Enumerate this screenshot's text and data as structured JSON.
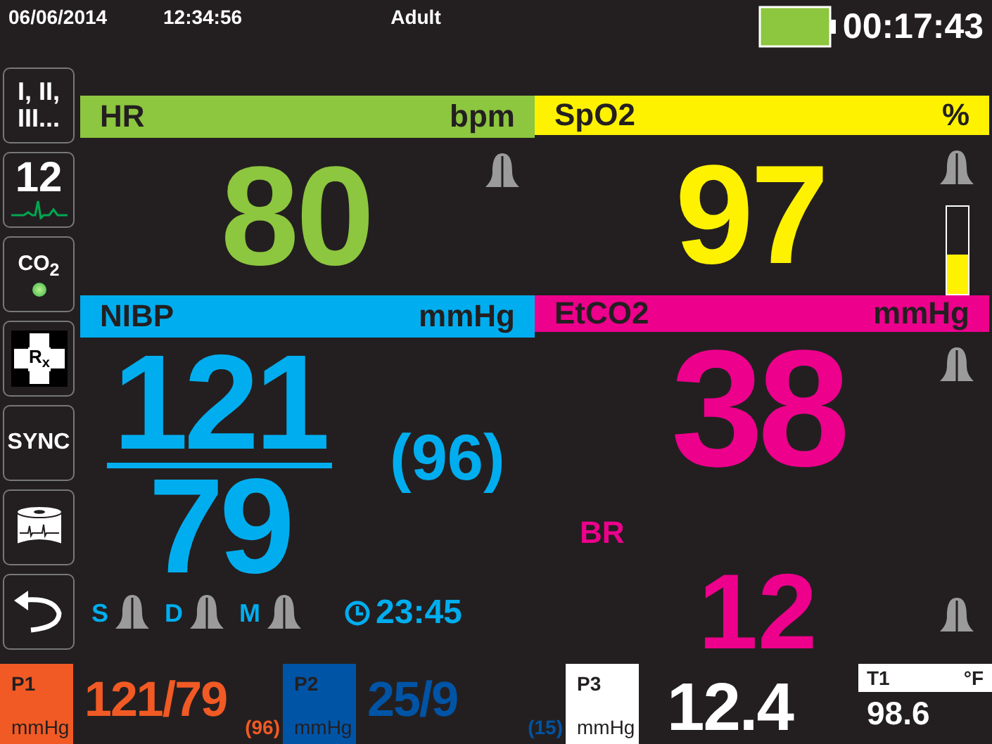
{
  "status_bar": {
    "date": "06/06/2014",
    "time": "12:34:56",
    "patient_mode": "Adult",
    "elapsed": "00:17:43"
  },
  "sidebar": {
    "buttons": [
      {
        "kind": "leads",
        "label": "I, II, III..."
      },
      {
        "kind": "twelve_lead",
        "label": "12"
      },
      {
        "kind": "co2",
        "label": "CO$_{2}$",
        "active": true
      },
      {
        "kind": "rx",
        "label": "R$_{x}$"
      },
      {
        "kind": "sync",
        "label": "SYNC"
      },
      {
        "kind": "print"
      },
      {
        "kind": "back"
      }
    ]
  },
  "vitals": [
    {
      "kind": "hr",
      "label": "HR",
      "unit": "bpm",
      "color": "#8dc63f",
      "value": "80"
    },
    {
      "kind": "spo2",
      "label": "SpO2",
      "unit": "%",
      "color": "#fff200",
      "value": "97",
      "level": 0.45
    },
    {
      "kind": "nibp",
      "label": "NIBP",
      "unit": "mmHg",
      "color": "#00aeef",
      "systolic": "121",
      "diastolic": "79",
      "mean": "(96)",
      "modes": [
        "S",
        "D",
        "M"
      ],
      "interval": "23:45"
    },
    {
      "kind": "etco2",
      "label": "EtCO2",
      "unit": "mmHg",
      "color": "#ec008c",
      "value": "38",
      "sub_label": "BR",
      "sub_value": "12"
    }
  ],
  "pressures": [
    {
      "label": "P1",
      "unit": "mmHg",
      "value": "121/79",
      "mean": "(96)",
      "color": "#f15a24"
    },
    {
      "label": "P2",
      "unit": "mmHg",
      "value": "25/9",
      "mean": "(15)",
      "color": "#0054a6"
    },
    {
      "label": "P3",
      "unit": "mmHg",
      "value": "12.4",
      "color": "#ffffff"
    }
  ],
  "temperature": {
    "label": "T1",
    "unit": "°F",
    "value": "98.6"
  }
}
